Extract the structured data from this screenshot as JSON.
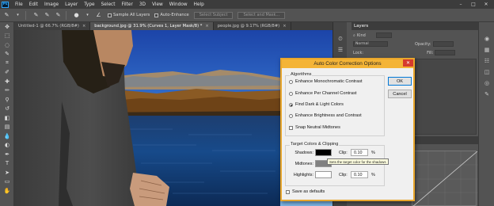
{
  "app": {
    "logo_text": "Ps"
  },
  "menu": [
    "File",
    "Edit",
    "Image",
    "Layer",
    "Type",
    "Select",
    "Filter",
    "3D",
    "View",
    "Window",
    "Help"
  ],
  "options_bar": {
    "sample_all_layers": "Sample All Layers",
    "auto_enhance": "Auto-Enhance",
    "select_subject": "Select Subject",
    "select_and_mask": "Select and Mask..."
  },
  "tabs": [
    {
      "label": "Untitled-1 @ 66.7% (RGB/8#)",
      "active": false
    },
    {
      "label": "background.jpg @ 31.9% (Curves 1, Layer Mask/8) *",
      "active": true
    },
    {
      "label": "people.jpg @ 9.17% (RGB/8#)",
      "active": false
    }
  ],
  "layers_panel": {
    "title": "Layers",
    "kind_label": "Kind",
    "blend_mode": "Normal",
    "opacity_label": "Opacity:",
    "lock_label": "Lock:",
    "fill_label": "Fill:"
  },
  "dialog": {
    "title": "Auto Color Correction Options",
    "algorithms_label": "Algorithms",
    "options": [
      {
        "label": "Enhance Monochromatic Contrast",
        "selected": false
      },
      {
        "label": "Enhance Per Channel Contrast",
        "selected": false
      },
      {
        "label": "Find Dark & Light Colors",
        "selected": true
      },
      {
        "label": "Enhance Brightness and Contrast",
        "selected": false
      }
    ],
    "snap_neutral_midtones": "Snap Neutral Midtones",
    "target_colors_label": "Target Colors & Clipping",
    "shadows_label": "Shadows:",
    "midtones_label": "Midtones:",
    "highlights_label": "Highlights:",
    "clip_label": "Clip:",
    "shadows_clip": "0.10",
    "highlights_clip": "0.10",
    "percent": "%",
    "ok_label": "OK",
    "cancel_label": "Cancel",
    "save_as_defaults": "Save as defaults",
    "tooltip": "Sets the target color for the shadows",
    "colors": {
      "shadows": "#000000",
      "midtones": "#808080",
      "highlights": "#ffffff",
      "title_bar": "#f4b437",
      "close": "#d63b2d"
    }
  },
  "colors": {
    "accent": "#31a8ff",
    "chrome": "#535353",
    "menubar": "#3c3c3c"
  }
}
